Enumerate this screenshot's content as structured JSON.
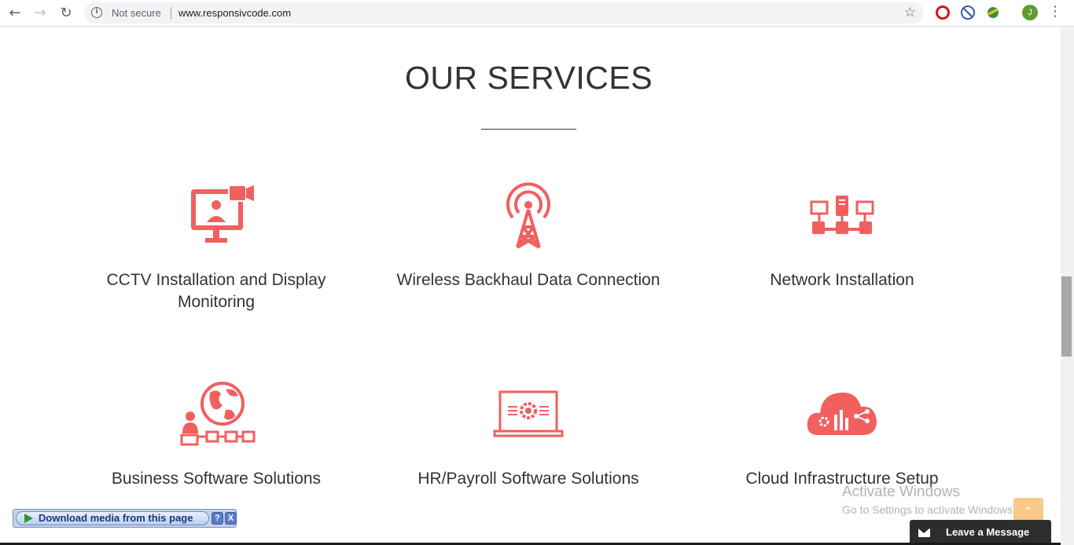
{
  "browser": {
    "back_icon": "arrow-left-icon",
    "forward_icon": "arrow-right-icon",
    "reload_icon": "reload-icon",
    "security_label": "Not secure",
    "url": "www.responsivcode.com",
    "avatar_letter": "J"
  },
  "page": {
    "heading": "OUR SERVICES",
    "accent_color": "#f25f5f",
    "services": [
      {
        "title": "CCTV Installation and Display Monitoring",
        "icon": "cctv-monitor-icon"
      },
      {
        "title": "Wireless Backhaul Data Connection",
        "icon": "wireless-tower-icon"
      },
      {
        "title": "Network Installation",
        "icon": "network-icon"
      },
      {
        "title": "Business Software Solutions",
        "icon": "globe-network-icon"
      },
      {
        "title": "HR/Payroll Software Solutions",
        "icon": "laptop-gear-icon"
      },
      {
        "title": "Cloud Infrastructure Setup",
        "icon": "cloud-analytics-icon"
      }
    ]
  },
  "overlays": {
    "download_label": "Download media from this page",
    "help_label": "?",
    "close_label": "X",
    "activate_title": "Activate Windows",
    "activate_sub": "Go to Settings to activate Windows.",
    "leave_message": "Leave a Message"
  }
}
